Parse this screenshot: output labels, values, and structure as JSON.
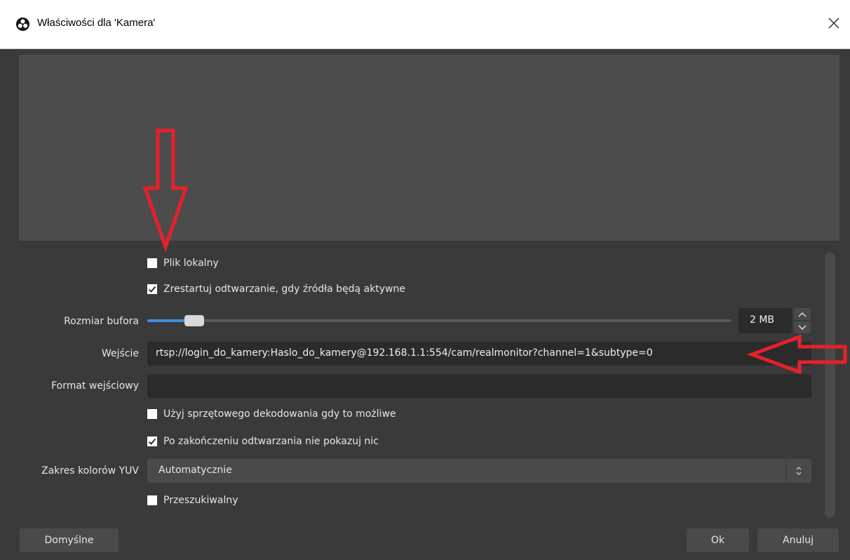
{
  "window": {
    "title": "Właściwości dla 'Kamera'",
    "close_glyph": "✕",
    "icon": "obs-logo-icon"
  },
  "form": {
    "local_file_label": "Plik lokalny",
    "local_file_checked": false,
    "restart_label": "Zrestartuj odtwarzanie, gdy źródła będą aktywne",
    "restart_checked": true,
    "buffer_label": "Rozmiar bufora",
    "buffer_value": "2 MB",
    "buffer_fraction": 0.08,
    "input_label": "Wejście",
    "input_value": "rtsp://login_do_kamery:Haslo_do_kamery@192.168.1.1:554/cam/realmonitor?channel=1&subtype=0",
    "format_label": "Format wejściowy",
    "format_value": "",
    "hw_decode_label": "Użyj sprzętowego dekodowania gdy to możliwe",
    "hw_decode_checked": false,
    "no_show_label": "Po zakończeniu odtwarzania nie pokazuj nic",
    "no_show_checked": true,
    "yuv_label": "Zakres kolorów YUV",
    "yuv_value": "Automatycznie",
    "seekable_label": "Przeszukiwalny",
    "seekable_checked": false
  },
  "buttons": {
    "defaults": "Domyślne",
    "ok": "Ok",
    "cancel": "Anuluj"
  },
  "colors": {
    "annotation_arrow": "#e8202a",
    "slider_accent": "#3d8fdd",
    "dialog_bg": "#3a3a3a",
    "field_bg": "#2b2b2b"
  }
}
